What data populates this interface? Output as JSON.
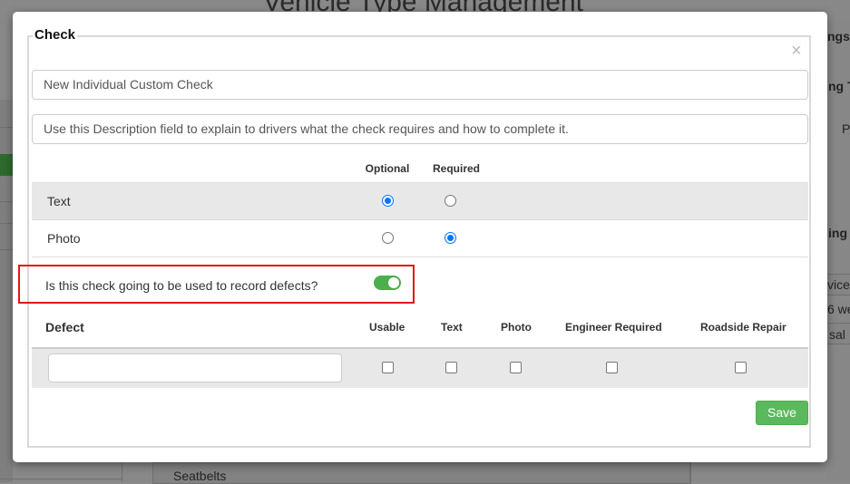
{
  "background": {
    "page_title": "Vehicle Type Management",
    "right_fragments": [
      "ngs",
      "ng T",
      "P",
      "ing",
      "vice",
      "6 we",
      "sal"
    ],
    "bottom_item": "Seatbelts"
  },
  "modal": {
    "legend": "Check",
    "close_symbol": "×",
    "name_value": "New Individual Custom Check",
    "description_value": "Use this Description field to explain to drivers what the check requires and how to complete it.",
    "options": {
      "columns": [
        "Optional",
        "Required"
      ],
      "rows": [
        {
          "label": "Text",
          "selected": "Optional"
        },
        {
          "label": "Photo",
          "selected": "Required"
        }
      ]
    },
    "defect_question": "Is this check going to be used to record defects?",
    "defect_toggle_on": true,
    "defect_table": {
      "headers": [
        "Defect",
        "Usable",
        "Text",
        "Photo",
        "Engineer Required",
        "Roadside Repair"
      ],
      "row": {
        "defect_value": "",
        "usable": false,
        "text": false,
        "photo": false,
        "engineer_required": false,
        "roadside_repair": false
      }
    },
    "save_label": "Save"
  },
  "colors": {
    "accent_blue": "#0075ff",
    "save_green": "#5cb85c",
    "highlight_red": "#e01818"
  }
}
